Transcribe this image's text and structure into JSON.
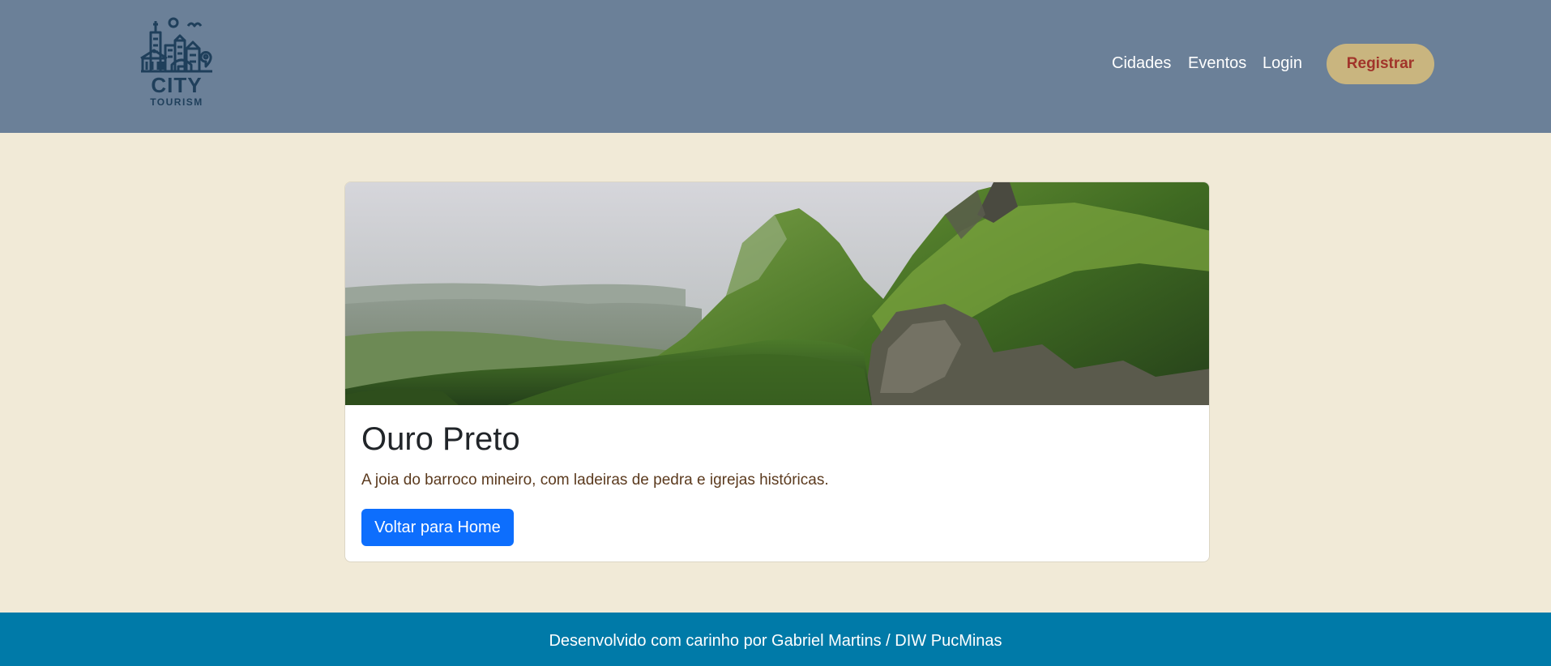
{
  "header": {
    "logo": {
      "line1": "CITY",
      "line2": "TOURISM",
      "icon": "city-skyline-icon"
    },
    "nav": [
      {
        "label": "Cidades"
      },
      {
        "label": "Eventos"
      },
      {
        "label": "Login"
      }
    ],
    "register_label": "Registrar"
  },
  "card": {
    "image": "mountain-landscape-image",
    "title": "Ouro Preto",
    "description": "A joia do barroco mineiro, com ladeiras de pedra e igrejas históricas.",
    "button_label": "Voltar para Home"
  },
  "footer": {
    "text": "Desenvolvido com carinho por Gabriel Martins / DIW PucMinas"
  },
  "colors": {
    "header_bg": "#6b8098",
    "page_bg": "#f1ead7",
    "register_bg": "#c9b57f",
    "register_text": "#a1342a",
    "primary_button": "#0d6efd",
    "footer_bg": "#007aa8"
  }
}
